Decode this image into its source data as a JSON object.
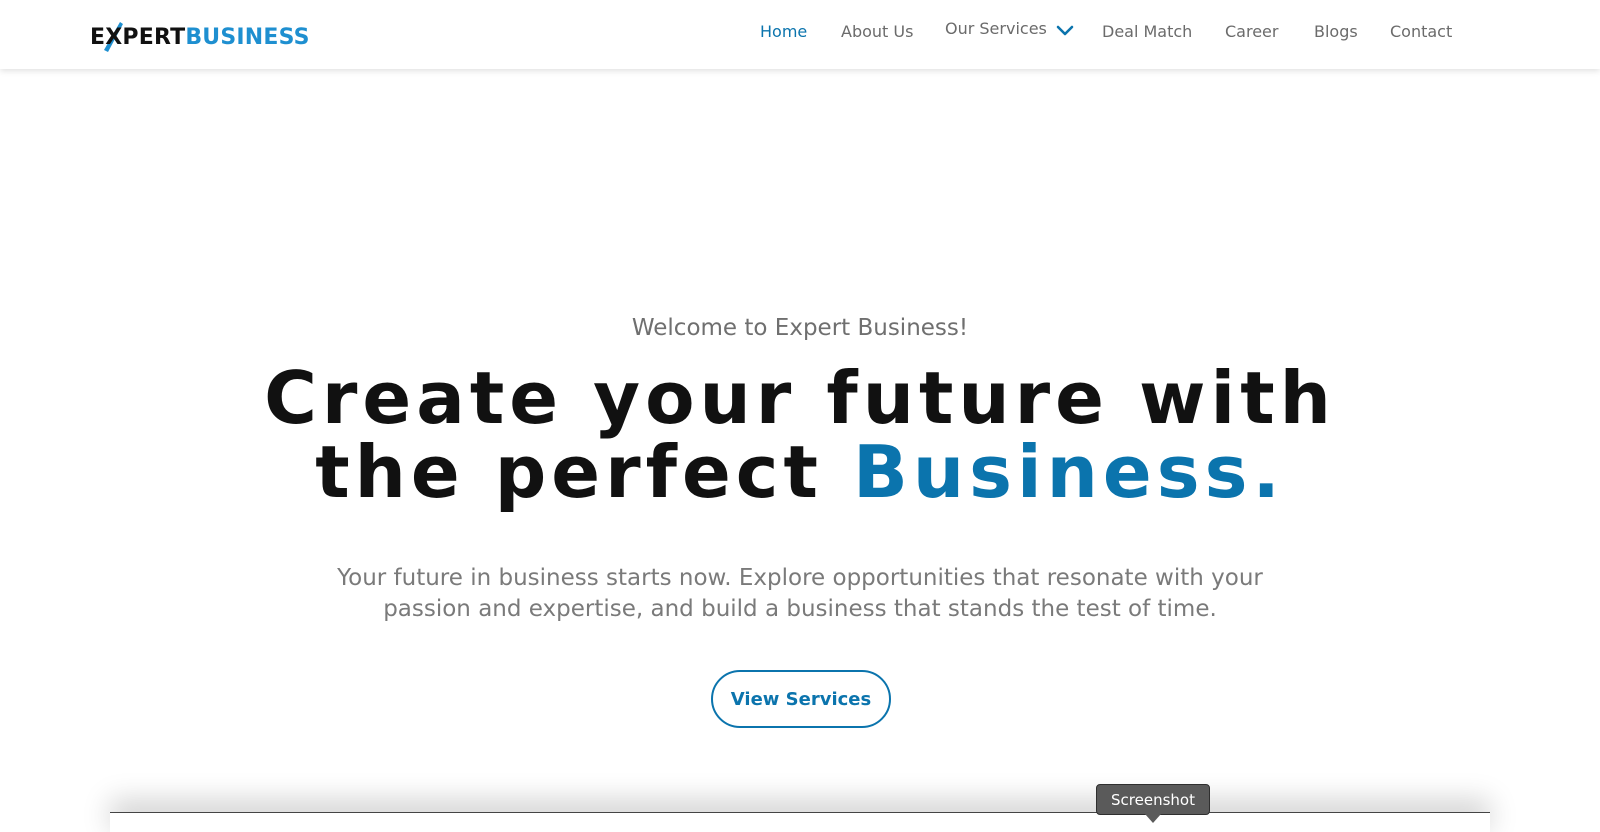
{
  "header": {
    "logo": {
      "part1": "EXPERT",
      "part2": "BUSINESS",
      "mark_icon": "check-swoosh-icon"
    },
    "nav": {
      "home": "Home",
      "about": "About Us",
      "services": "Our Services",
      "deal_match": "Deal Match",
      "career": "Career",
      "blogs": "Blogs",
      "contact": "Contact"
    }
  },
  "hero": {
    "welcome": "Welcome to Expert Business!",
    "headline_line1": "Create your future with",
    "headline_line2_prefix": "the perfect ",
    "headline_accent": "Business.",
    "subtext": "Your future in business starts now. Explore opportunities that resonate with your passion and expertise, and build a business that stands the test of time.",
    "cta": "View Services"
  },
  "tooltip": {
    "text": "Screenshot"
  },
  "colors": {
    "brand_blue": "#0b74ad",
    "logo_blue": "#1e8fd0",
    "text_dark": "#111111",
    "text_muted": "#7a7a7a"
  }
}
